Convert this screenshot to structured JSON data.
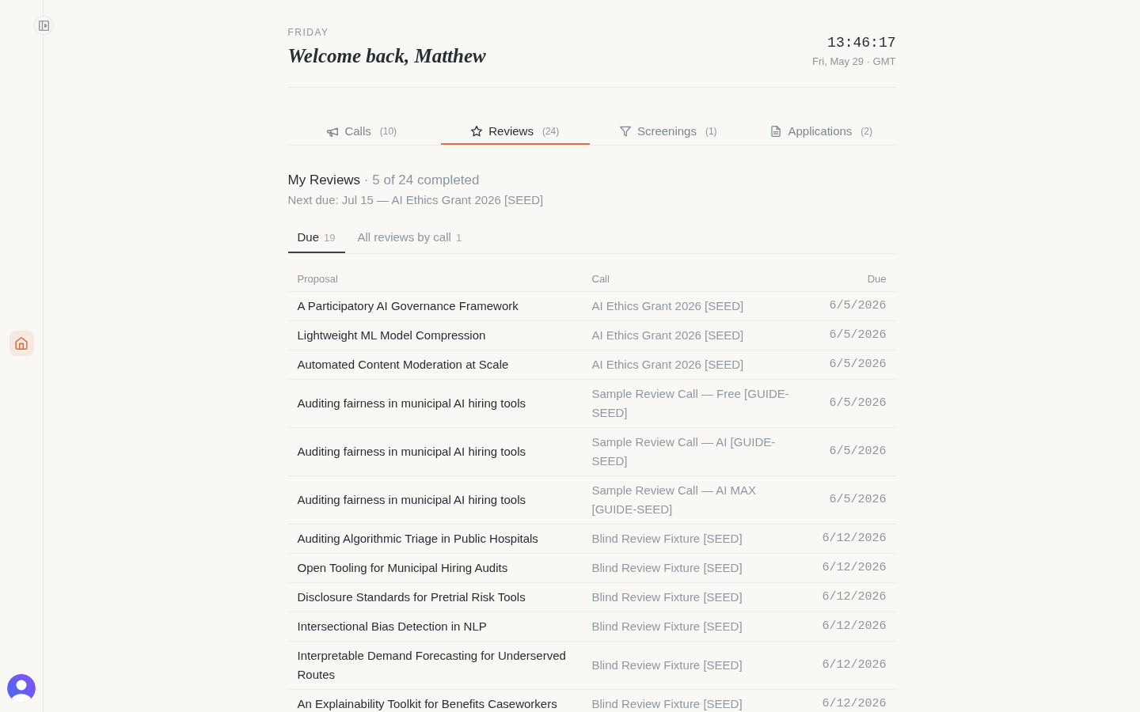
{
  "sidebar": {
    "items": [
      {
        "selected": true
      }
    ]
  },
  "header": {
    "day": "FRIDAY",
    "greeting": "Welcome back, Matthew",
    "clock": "13:46:17",
    "date": "Fri, May 29 · GMT"
  },
  "tabs": [
    {
      "label": "Calls",
      "count": "(10)",
      "selected": false
    },
    {
      "label": "Reviews",
      "count": "(24)",
      "selected": true
    },
    {
      "label": "Screenings",
      "count": "(1)",
      "selected": false
    },
    {
      "label": "Applications",
      "count": "(2)",
      "selected": false
    }
  ],
  "summary": {
    "title": "My Reviews",
    "progress": "· 5 of 24 completed",
    "next_due": "Next due: Jul 15 — AI Ethics Grant 2026 [SEED]"
  },
  "subtabs": [
    {
      "label": "Due",
      "count": "19",
      "selected": true
    },
    {
      "label": "All reviews by call",
      "count": "1",
      "selected": false
    }
  ],
  "table": {
    "columns": [
      "Proposal",
      "Call",
      "Due"
    ],
    "rows": [
      {
        "proposal": "A Participatory AI Governance Framework",
        "call": "AI Ethics Grant 2026 [SEED]",
        "due": "6/5/2026"
      },
      {
        "proposal": "Lightweight ML Model Compression",
        "call": "AI Ethics Grant 2026 [SEED]",
        "due": "6/5/2026"
      },
      {
        "proposal": "Automated Content Moderation at Scale",
        "call": "AI Ethics Grant 2026 [SEED]",
        "due": "6/5/2026"
      },
      {
        "proposal": "Auditing fairness in municipal AI hiring tools",
        "call": "Sample Review Call — Free [GUIDE-SEED]",
        "due": "6/5/2026"
      },
      {
        "proposal": "Auditing fairness in municipal AI hiring tools",
        "call": "Sample Review Call — AI [GUIDE-SEED]",
        "due": "6/5/2026"
      },
      {
        "proposal": "Auditing fairness in municipal AI hiring tools",
        "call": "Sample Review Call — AI MAX [GUIDE-SEED]",
        "due": "6/5/2026"
      },
      {
        "proposal": "Auditing Algorithmic Triage in Public Hospitals",
        "call": "Blind Review Fixture [SEED]",
        "due": "6/12/2026"
      },
      {
        "proposal": "Open Tooling for Municipal Hiring Audits",
        "call": "Blind Review Fixture [SEED]",
        "due": "6/12/2026"
      },
      {
        "proposal": "Disclosure Standards for Pretrial Risk Tools",
        "call": "Blind Review Fixture [SEED]",
        "due": "6/12/2026"
      },
      {
        "proposal": "Intersectional Bias Detection in NLP",
        "call": "Blind Review Fixture [SEED]",
        "due": "6/12/2026"
      },
      {
        "proposal": "Interpretable Demand Forecasting for Underserved Routes",
        "call": "Blind Review Fixture [SEED]",
        "due": "6/12/2026"
      },
      {
        "proposal": "An Explainability Toolkit for Benefits Caseworkers",
        "call": "Blind Review Fixture [SEED]",
        "due": "6/12/2026"
      }
    ]
  }
}
